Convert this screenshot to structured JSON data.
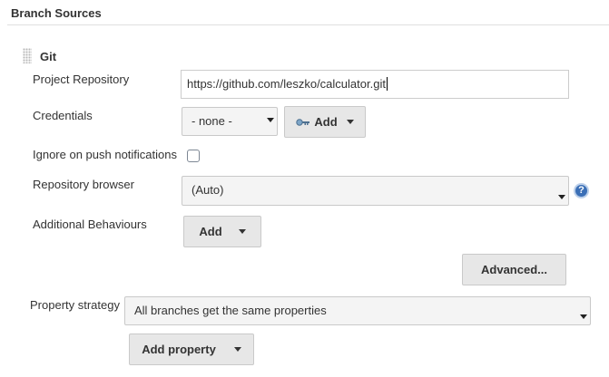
{
  "section": {
    "title": "Branch Sources"
  },
  "source": {
    "type_label": "Git",
    "project_repository": {
      "label": "Project Repository",
      "value": "https://github.com/leszko/calculator.git"
    },
    "credentials": {
      "label": "Credentials",
      "selected": "- none -",
      "add_label": "Add",
      "add_icon": "key-icon"
    },
    "ignore_on_push": {
      "label": "Ignore on push notifications",
      "checked": false
    },
    "repository_browser": {
      "label": "Repository browser",
      "selected": "(Auto)",
      "help_icon": "help-icon",
      "help_glyph": "?"
    },
    "additional_behaviours": {
      "label": "Additional Behaviours",
      "add_label": "Add"
    },
    "advanced_label": "Advanced..."
  },
  "property_strategy": {
    "label": "Property strategy",
    "selected": "All branches get the same properties",
    "add_property_label": "Add property"
  },
  "colors": {
    "help_icon": "#3b6fb6",
    "button_bg": "#e7e7e7",
    "select_bg": "#f4f4f4"
  }
}
